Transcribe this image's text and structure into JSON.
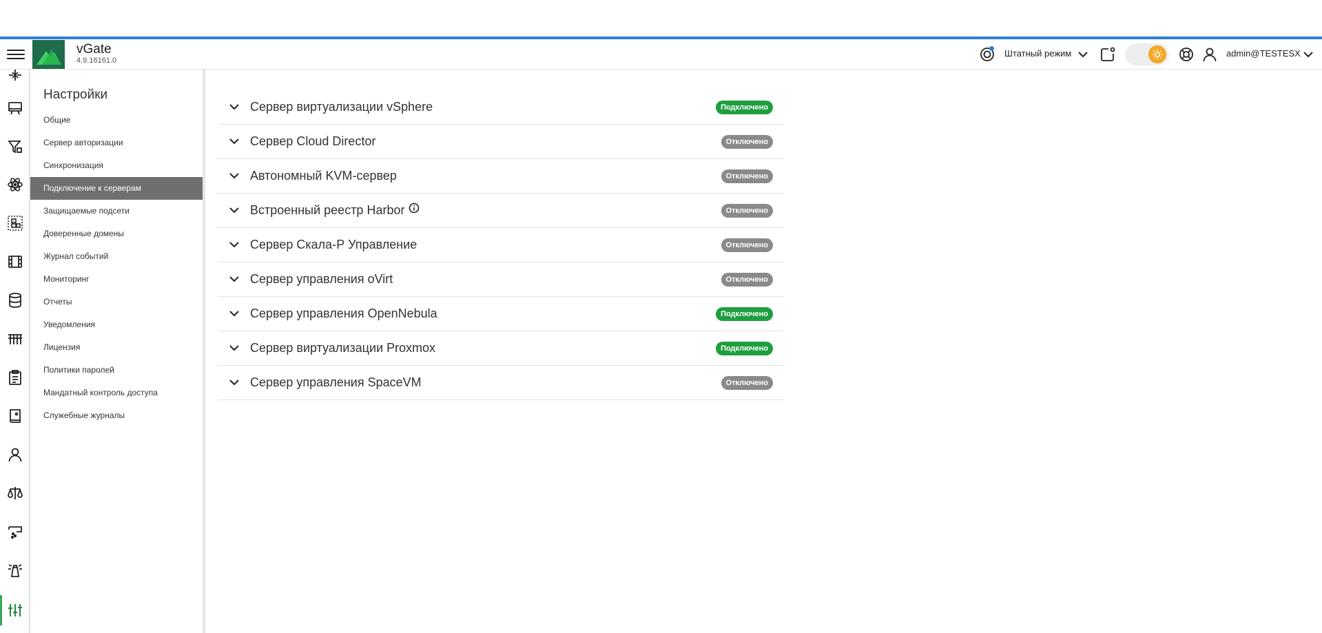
{
  "app": {
    "name": "vGate",
    "version": "4.9.16161.0"
  },
  "header": {
    "mode_label": "Штатный режим",
    "user": "admin@TESTESX"
  },
  "colors": {
    "accent": "#2d7fd6",
    "connected": "#1f9e3f",
    "disconnected": "#8a8a8a",
    "active_menu": "#6f6f6f",
    "logo": "#1f6b4b"
  },
  "rail_icons": [
    "network-icon",
    "monitor-icon",
    "filter-icon",
    "atom-icon",
    "hierarchy-icon",
    "film-icon",
    "database-icon",
    "grid-icon",
    "clipboard-icon",
    "document-icon",
    "user-icon",
    "scales-icon",
    "report-icon",
    "lighthouse-icon",
    "sliders-icon"
  ],
  "settings": {
    "title": "Настройки",
    "menu": [
      "Общие",
      "Сервер авторизации",
      "Синхронизация",
      "Подключение к серверам",
      "Защищаемые подсети",
      "Доверенные домены",
      "Журнал событий",
      "Мониторинг",
      "Отчеты",
      "Уведомления",
      "Лицензия",
      "Политики паролей",
      "Мандатный контроль доступа",
      "Служебные журналы"
    ],
    "active_index": 3
  },
  "servers": [
    {
      "name": "Сервер виртуализации vSphere",
      "status": "Подключено",
      "connected": true
    },
    {
      "name": "Сервер Cloud Director",
      "status": "Отключено",
      "connected": false
    },
    {
      "name": "Автономный KVM-сервер",
      "status": "Отключено",
      "connected": false
    },
    {
      "name": "Встроенный реестр Harbor",
      "status": "Отключено",
      "connected": false
    },
    {
      "name": "Сервер Скала-Р Управление",
      "status": "Отключено",
      "connected": false
    },
    {
      "name": "Сервер управления oVirt",
      "status": "Отключено",
      "connected": false
    },
    {
      "name": "Сервер управления OpenNebula",
      "status": "Подключено",
      "connected": true
    },
    {
      "name": "Сервер виртуализации Proxmox",
      "status": "Подключено",
      "connected": true
    },
    {
      "name": "Сервер управления SpaceVM",
      "status": "Отключено",
      "connected": false
    }
  ]
}
